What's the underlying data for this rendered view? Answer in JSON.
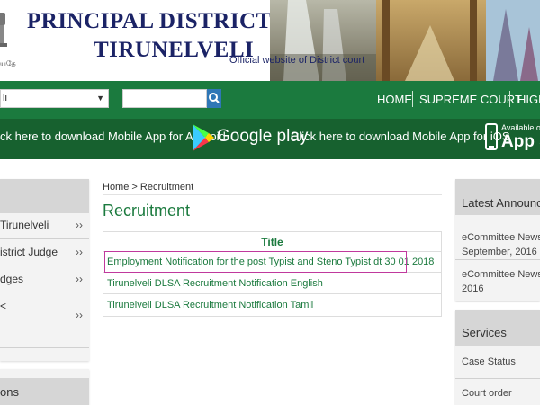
{
  "header": {
    "title_line1": "PRINCIPAL DISTRICT COURT",
    "title_line2": "TIRUNELVELI",
    "emblem_caption": "யதே",
    "official_text": "Official website of District court"
  },
  "nav": {
    "select_value": "li",
    "select_arrow": "▼",
    "search_placeholder": "",
    "links": [
      "HOME",
      "SUPREME COURT",
      "HIGH"
    ]
  },
  "appbar": {
    "android_text": "ck here to download Mobile App for Android",
    "gplay_text": "Google play",
    "ios_text": "Click here to download Mobile App for iOS",
    "available_text": "Available o",
    "appstore_text": "App St"
  },
  "left_sidebar": {
    "items": [
      {
        "label": "Tirunelveli",
        "chevron": "››"
      },
      {
        "label": "istrict Judge",
        "chevron": "››"
      },
      {
        "label": "dges",
        "chevron": "››"
      },
      {
        "label": "<",
        "chevron": "››"
      }
    ],
    "section2_title": "ons"
  },
  "main": {
    "breadcrumb": "Home > Recruitment",
    "title": "Recruitment",
    "table_header": "Title",
    "rows": [
      "Employment Notification for the post Typist and Steno Typist dt 30 01 2018",
      "Tirunelveli DLSA Recruitment Notification English",
      "Tirunelveli DLSA Recruitment Notification Tamil"
    ]
  },
  "right_sidebar": {
    "announcements_title": "Latest Announcem",
    "announcements": [
      {
        "line1": "eCommittee Newslette",
        "line2": "September, 2016"
      },
      {
        "line1": "eCommittee Newslette",
        "line2": "2016"
      }
    ],
    "services_title": "Services",
    "services": [
      "Case Status",
      "Court order"
    ]
  },
  "colors": {
    "nav_green": "#1b7a3e",
    "appbar_green": "#17612f",
    "title_navy": "#1b2366",
    "highlight": "#c0399d"
  }
}
